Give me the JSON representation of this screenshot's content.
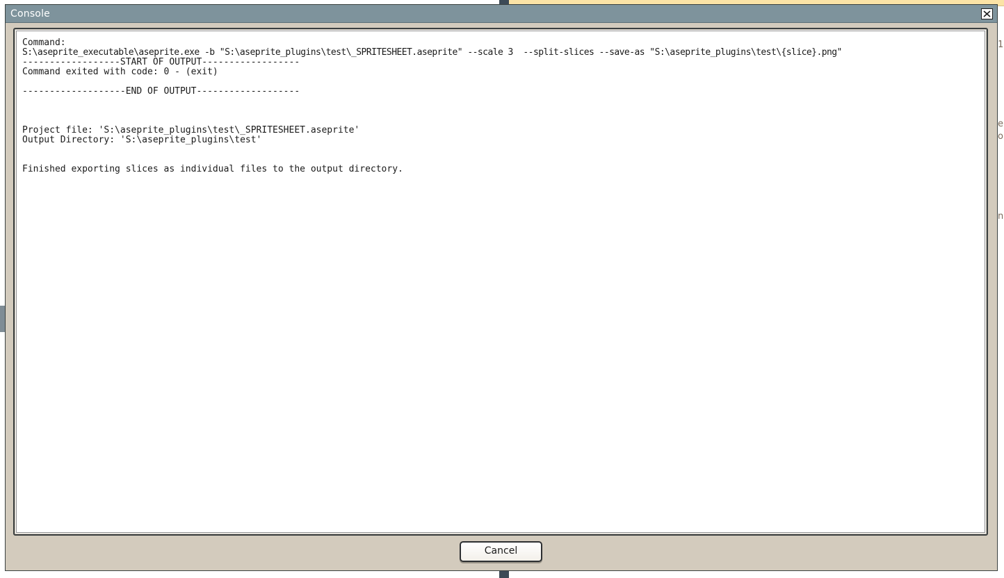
{
  "window": {
    "title": "Console"
  },
  "background": {
    "right_glyphs": [
      "1.",
      "e",
      "o",
      "n"
    ]
  },
  "console": {
    "lines": [
      "Command:",
      "S:\\aseprite_executable\\aseprite.exe -b \"S:\\aseprite_plugins\\test\\_SPRITESHEET.aseprite\" --scale 3  --split-slices --save-as \"S:\\aseprite_plugins\\test\\{slice}.png\"",
      "------------------START OF OUTPUT------------------",
      "Command exited with code: 0 - (exit)",
      "",
      "-------------------END OF OUTPUT-------------------",
      "",
      "",
      "",
      "Project file: 'S:\\aseprite_plugins\\test\\_SPRITESHEET.aseprite'",
      "Output Directory: 'S:\\aseprite_plugins\\test'",
      "",
      "",
      "Finished exporting slices as individual files to the output directory."
    ]
  },
  "buttons": {
    "cancel_label": "Cancel"
  },
  "colors": {
    "titlebar": "#7e939c",
    "window_body": "#d3cbbd",
    "output_background": "#ffffff"
  }
}
